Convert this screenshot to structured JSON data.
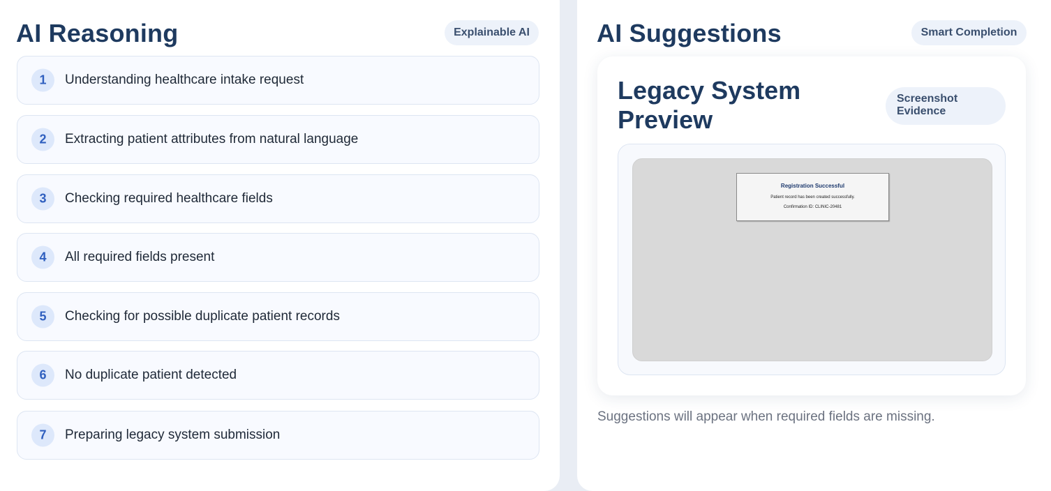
{
  "reasoning": {
    "title": "AI Reasoning",
    "badge": "Explainable AI",
    "steps": [
      {
        "number": "1",
        "text": "Understanding healthcare intake request"
      },
      {
        "number": "2",
        "text": "Extracting patient attributes from natural language"
      },
      {
        "number": "3",
        "text": "Checking required healthcare fields"
      },
      {
        "number": "4",
        "text": "All required fields present"
      },
      {
        "number": "5",
        "text": "Checking for possible duplicate patient records"
      },
      {
        "number": "6",
        "text": "No duplicate patient detected"
      },
      {
        "number": "7",
        "text": "Preparing legacy system submission"
      }
    ]
  },
  "suggestions": {
    "title": "AI Suggestions",
    "badge": "Smart Completion",
    "preview": {
      "title": "Legacy System Preview",
      "badge": "Screenshot\nEvidence",
      "screenshot": {
        "dialog_title": "Registration Successful",
        "dialog_message": "Patient record has been created successfully.",
        "confirmation": "Confirmation ID: CLINIC-20481"
      }
    },
    "empty_hint": "Suggestions will appear when required fields are missing."
  }
}
